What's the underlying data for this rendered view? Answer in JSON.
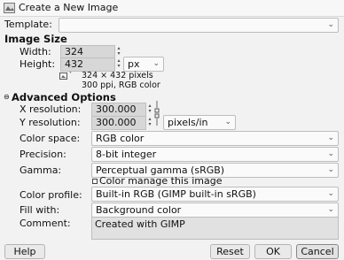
{
  "window": {
    "title": "Create a New Image"
  },
  "template": {
    "label": "Template:",
    "value": ""
  },
  "image_size": {
    "heading": "Image Size",
    "width_label": "Width:",
    "width_value": "324",
    "height_label": "Height:",
    "height_value": "432",
    "unit": "px",
    "summary_line1": "324 × 432 pixels",
    "summary_line2": "300 ppi, RGB color"
  },
  "advanced": {
    "heading": "Advanced Options",
    "x_res_label": "X resolution:",
    "x_res_value": "300.000",
    "y_res_label": "Y resolution:",
    "y_res_value": "300.000",
    "res_unit": "pixels/in",
    "color_space_label": "Color space:",
    "color_space_value": "RGB color",
    "precision_label": "Precision:",
    "precision_value": "8-bit integer",
    "gamma_label": "Gamma:",
    "gamma_value": "Perceptual gamma (sRGB)",
    "color_manage_label": "Color manage this image",
    "color_profile_label": "Color profile:",
    "color_profile_value": "Built-in RGB (GIMP built-in sRGB)",
    "fill_label": "Fill with:",
    "fill_value": "Background color",
    "comment_label": "Comment:",
    "comment_value": "Created with GIMP"
  },
  "buttons": {
    "help": "Help",
    "reset": "Reset",
    "ok": "OK",
    "cancel": "Cancel"
  }
}
